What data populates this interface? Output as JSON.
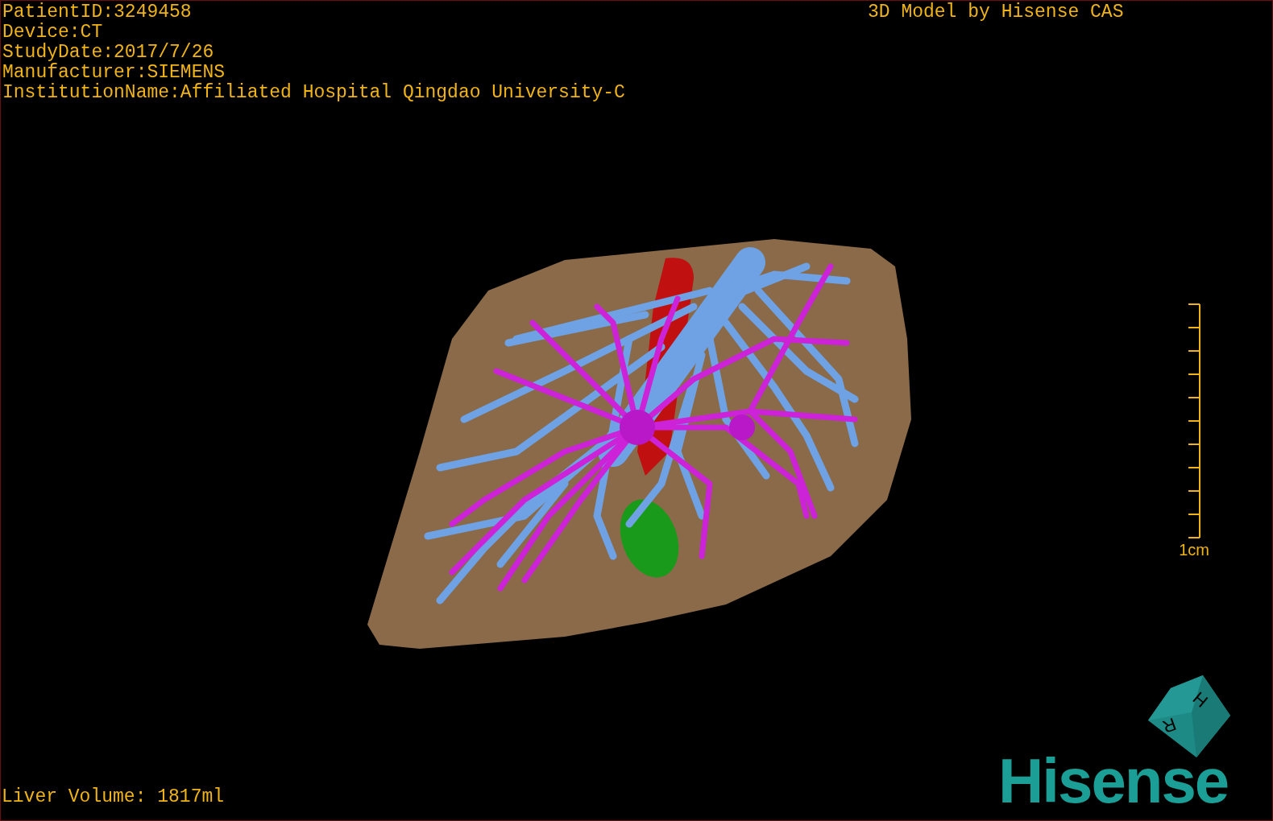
{
  "patient_info": [
    "PatientID:3249458",
    "Device:CT",
    "StudyDate:2017/7/26",
    "Manufacturer:SIEMENS",
    "InstitutionName:Affiliated Hospital Qingdao University-C"
  ],
  "title": "3D Model by Hisense CAS",
  "scale_bar": {
    "label": "1cm"
  },
  "orientation_cube": {
    "faces": [
      "H",
      "R"
    ]
  },
  "logo": "Hisense",
  "liver_volume": "Liver Volume: 1817ml"
}
